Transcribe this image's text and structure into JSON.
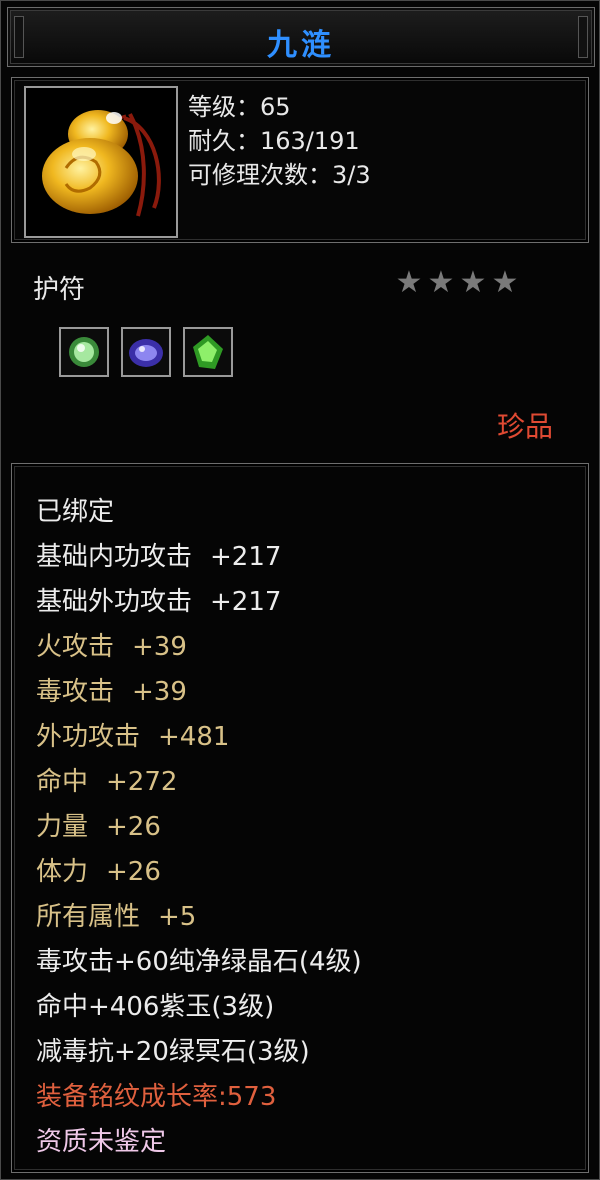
{
  "title": "九涟",
  "item": {
    "icon": "yellow-jade-amulet-icon",
    "stats": [
      {
        "label": "等级：",
        "value": "65"
      },
      {
        "label": "耐久：",
        "value": "163/191"
      },
      {
        "label": "可修理次数：",
        "value": "3/3"
      }
    ],
    "type": "护符",
    "stars": 4,
    "rarity": "珍品",
    "gem_sockets": [
      "green-crystal-gem-icon",
      "purple-jade-gem-icon",
      "green-stone-gem-icon"
    ]
  },
  "attributes": [
    {
      "name": "已绑定",
      "value": "",
      "color": "#ececec"
    },
    {
      "name": "基础内功攻击",
      "value": "+217",
      "color": "#ececec"
    },
    {
      "name": "基础外功攻击",
      "value": "+217",
      "color": "#ececec"
    },
    {
      "name": "火攻击",
      "value": "+39",
      "color": "#d8c188"
    },
    {
      "name": "毒攻击",
      "value": "+39",
      "color": "#d8c188"
    },
    {
      "name": "外功攻击",
      "value": "+481",
      "color": "#d8c188"
    },
    {
      "name": "命中",
      "value": "+272",
      "color": "#d8c188"
    },
    {
      "name": "力量",
      "value": "+26",
      "color": "#d8c188"
    },
    {
      "name": "体力",
      "value": "+26",
      "color": "#d8c188"
    },
    {
      "name": "所有属性",
      "value": "+5",
      "color": "#d8c188"
    },
    {
      "name": "毒攻击+60纯净绿晶石(4级)",
      "value": "",
      "color": "#ececec"
    },
    {
      "name": "命中+406紫玉(3级)",
      "value": "",
      "color": "#ececec"
    },
    {
      "name": "减毒抗+20绿冥石(3级)",
      "value": "",
      "color": "#ececec"
    },
    {
      "name": "装备铭纹成长率:573",
      "value": "",
      "color": "#e0603e"
    },
    {
      "name": "资质未鉴定",
      "value": "",
      "color": "#efc8e8"
    }
  ]
}
